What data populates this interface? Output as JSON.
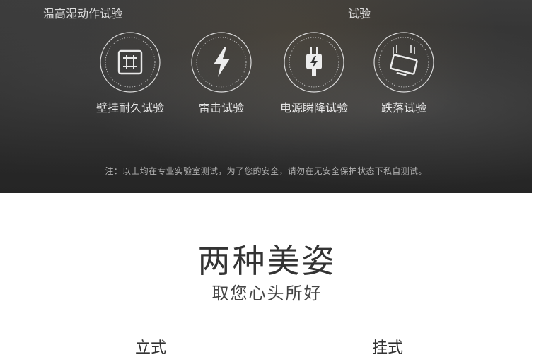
{
  "tests_section": {
    "top_left_label": "温高湿动作试验",
    "top_mid_label": "试验",
    "items": [
      {
        "label": "壁挂耐久试验",
        "icon": "wall-mount-icon"
      },
      {
        "label": "雷击试验",
        "icon": "lightning-icon"
      },
      {
        "label": "电源瞬降试验",
        "icon": "power-plug-icon"
      },
      {
        "label": "跌落试验",
        "icon": "drop-device-icon"
      }
    ],
    "note": "注：以上均在专业实验室测试，为了您的安全，请勿在无安全保护状态下私自测试。"
  },
  "styles_section": {
    "title": "两种美姿",
    "subtitle": "取您心头所好",
    "tabs": [
      "立式",
      "挂式"
    ]
  }
}
